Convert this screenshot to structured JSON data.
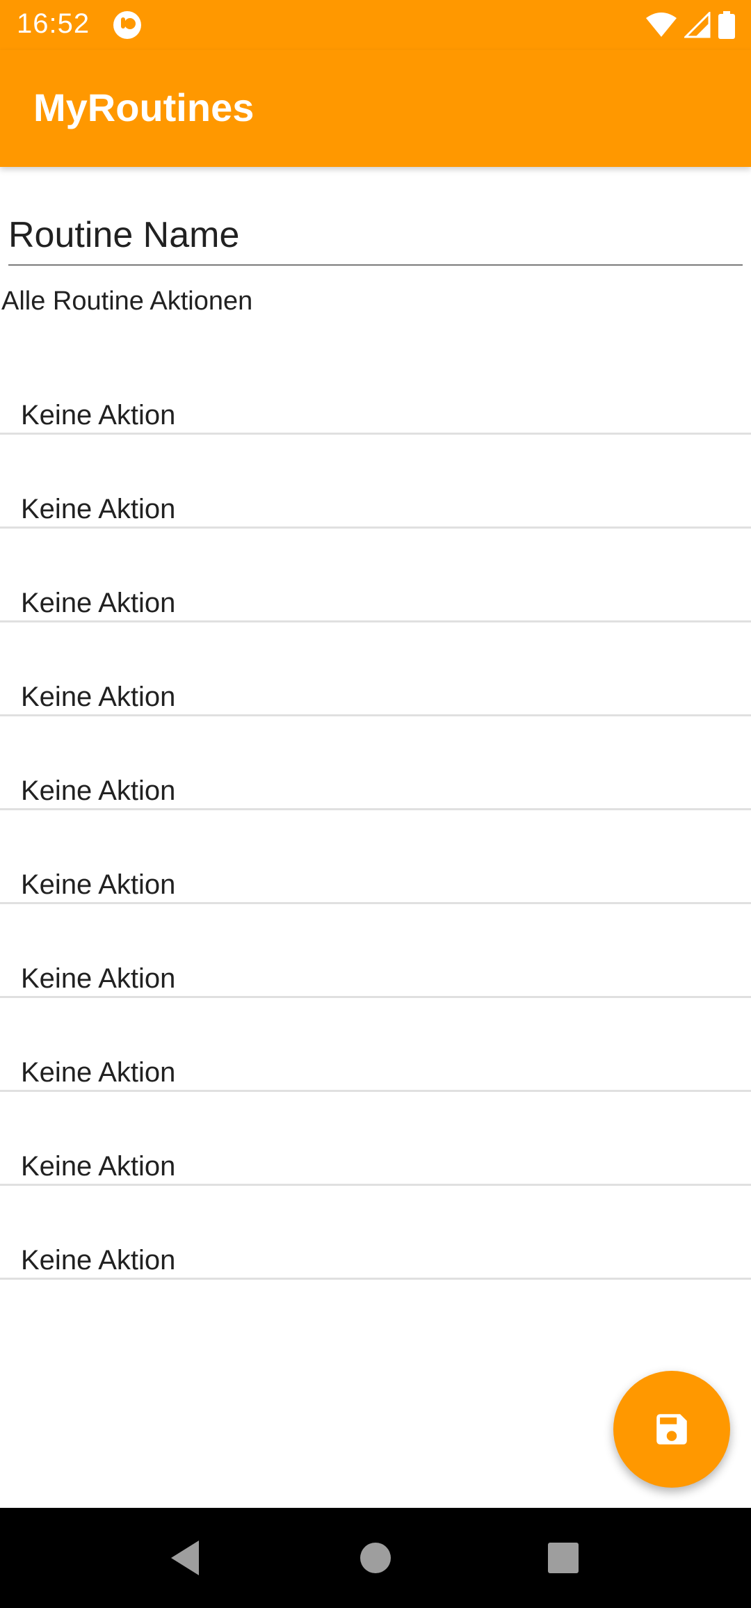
{
  "status_bar": {
    "time": "16:52",
    "icons": [
      "app-notification-icon",
      "wifi-icon",
      "signal-icon",
      "battery-icon"
    ]
  },
  "app_bar": {
    "title": "MyRoutines"
  },
  "form": {
    "routine_name_placeholder": "Routine Name",
    "section_label": "Alle Routine Aktionen"
  },
  "actions": [
    {
      "label": "Keine Aktion"
    },
    {
      "label": "Keine Aktion"
    },
    {
      "label": "Keine Aktion"
    },
    {
      "label": "Keine Aktion"
    },
    {
      "label": "Keine Aktion"
    },
    {
      "label": "Keine Aktion"
    },
    {
      "label": "Keine Aktion"
    },
    {
      "label": "Keine Aktion"
    },
    {
      "label": "Keine Aktion"
    },
    {
      "label": "Keine Aktion"
    }
  ],
  "fab": {
    "icon": "save-icon"
  },
  "nav_bar": {
    "buttons": [
      "back-icon",
      "home-icon",
      "recents-icon"
    ]
  },
  "colors": {
    "accent": "#FF9800",
    "text": "#212121",
    "divider": "#E0E0E0",
    "nav_background": "#000000"
  }
}
